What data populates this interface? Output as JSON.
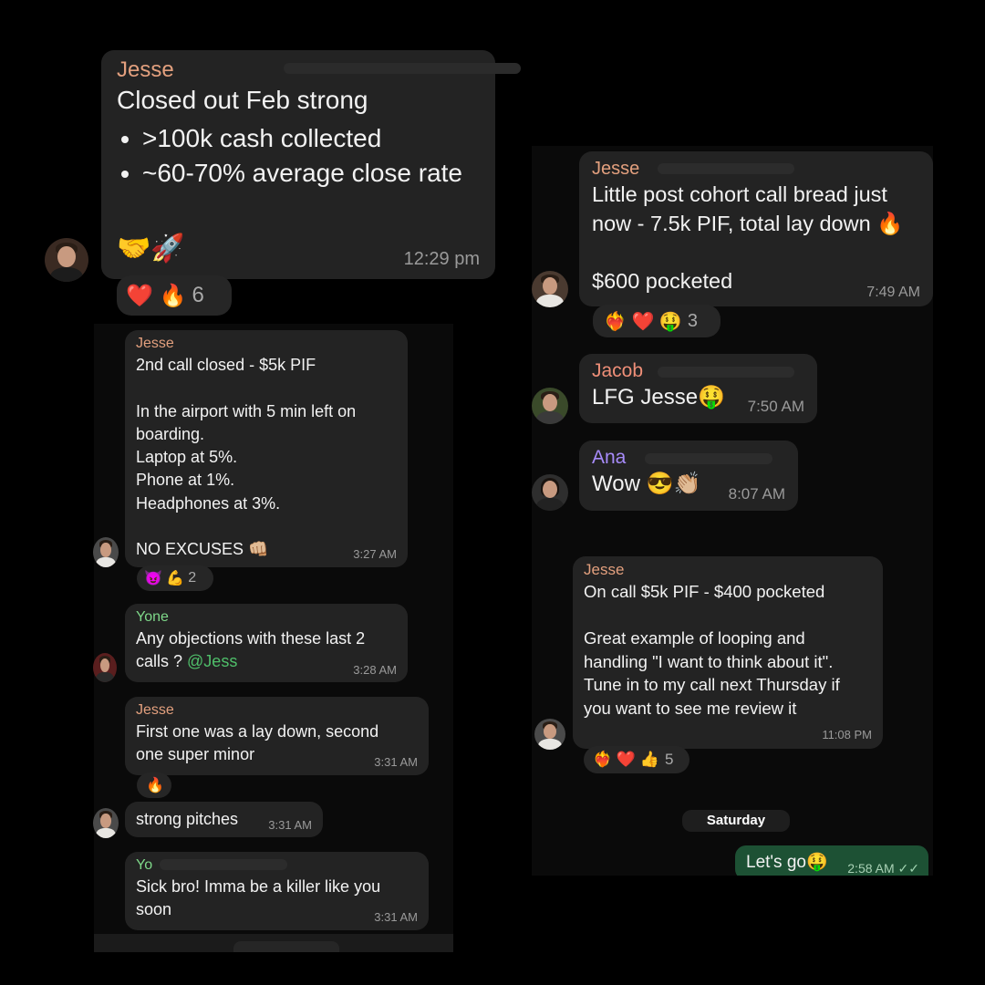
{
  "left": {
    "m1": {
      "sender": "Jesse",
      "text": "Closed out Feb strong",
      "bullets": [
        ">100k cash collected",
        "~60-70% average close rate"
      ],
      "emojis": "🤝🚀",
      "time": "12:29 pm",
      "reactions": {
        "emojis": "❤️ 🔥",
        "count": "6"
      }
    },
    "m2": {
      "sender": "Jesse",
      "text": "2nd call closed - $5k PIF\n\nIn the airport with 5 min left on boarding.\nLaptop at 5%.\nPhone at 1%.\nHeadphones at 3%.\n\nNO EXCUSES 👊🏼",
      "time": "3:27 AM",
      "reactions": {
        "emojis": "😈 💪",
        "count": "2"
      }
    },
    "m3": {
      "sender": "Yone",
      "text": "Any objections with these last 2 calls ? ",
      "mention": "@Jess",
      "time": "3:28 AM"
    },
    "m4": {
      "sender": "Jesse",
      "text": "First one was a lay down, second one super minor",
      "time": "3:31 AM",
      "reactions": {
        "emojis": "🔥"
      }
    },
    "m5": {
      "text": "strong pitches",
      "time": "3:31 AM"
    },
    "m6": {
      "sender": "Yo",
      "text": "Sick bro! Imma be a killer like you soon",
      "time": "3:31 AM"
    }
  },
  "right": {
    "m1": {
      "sender": "Jesse",
      "text": "Little post cohort call bread just now - 7.5k PIF, total lay down 🔥\n\n$600 pocketed",
      "time": "7:49 AM",
      "reactions": {
        "emojis": "❤️‍🔥 ❤️ 🤑",
        "count": "3"
      }
    },
    "m2": {
      "sender": "Jacob",
      "text": "LFG Jesse🤑",
      "time": "7:50 AM"
    },
    "m3": {
      "sender": "Ana",
      "text": "Wow 😎👏🏼",
      "time": "8:07 AM"
    },
    "m4": {
      "sender": "Jesse",
      "text": "On call $5k PIF - $400 pocketed\n\nGreat example of looping and handling \"I want to think about it\". Tune in to my call next Thursday if you want to see me review it",
      "time": "11:08 PM",
      "reactions": {
        "emojis": "❤️‍🔥 ❤️ 👍",
        "count": "5"
      }
    },
    "day": "Saturday",
    "m5": {
      "text": "Let's go🤑",
      "time": "2:58 AM",
      "status": "✓✓"
    }
  }
}
